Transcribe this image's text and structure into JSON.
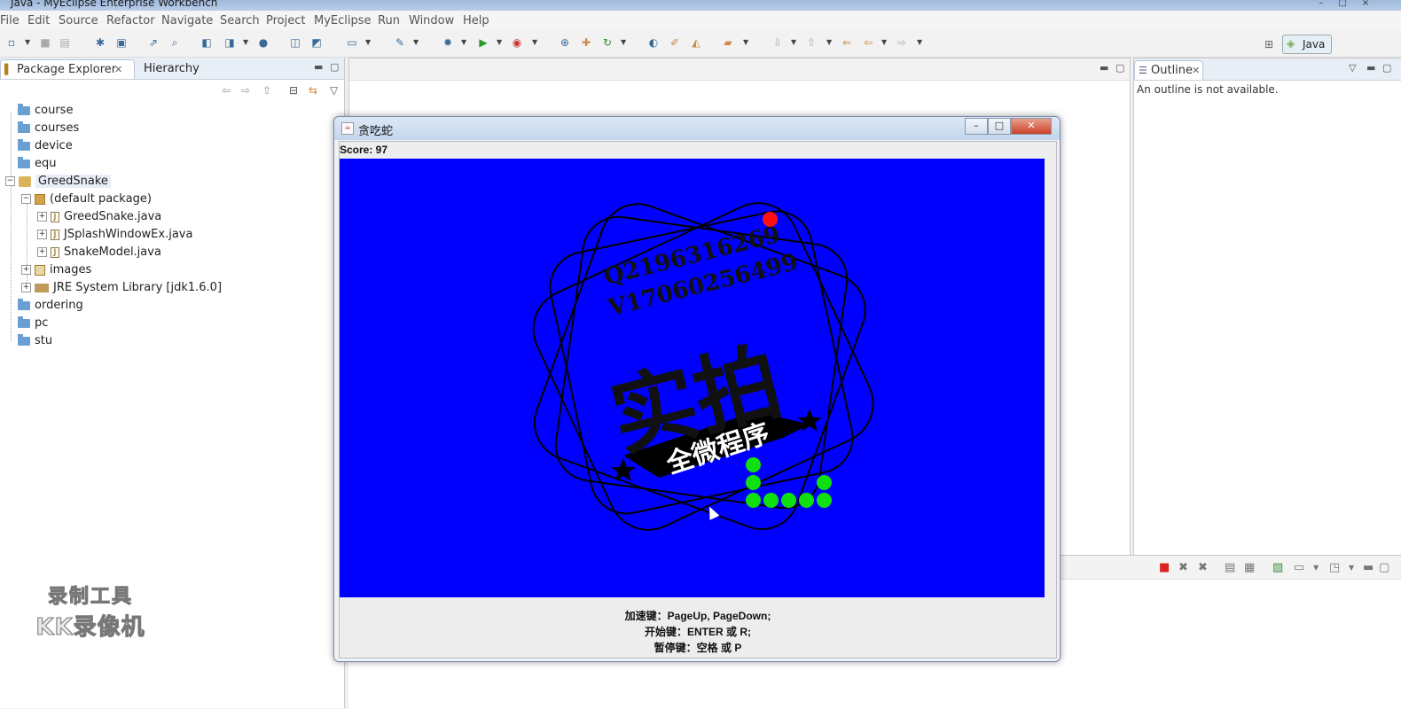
{
  "window": {
    "title": "Java - MyEclipse Enterprise Workbench"
  },
  "menu": [
    "File",
    "Edit",
    "Source",
    "Refactor",
    "Navigate",
    "Search",
    "Project",
    "MyEclipse",
    "Run",
    "Window",
    "Help"
  ],
  "perspective": {
    "label": "Java"
  },
  "package_explorer": {
    "tab_label": "Package Explorer",
    "hierarchy_label": "Hierarchy",
    "tree": [
      {
        "label": "course"
      },
      {
        "label": "courses"
      },
      {
        "label": "device"
      },
      {
        "label": "equ"
      },
      {
        "label": "GreedSnake"
      },
      {
        "label": "(default package)"
      },
      {
        "label": "GreedSnake.java"
      },
      {
        "label": "JSplashWindowEx.java"
      },
      {
        "label": "SnakeModel.java"
      },
      {
        "label": "images"
      },
      {
        "label": "JRE System Library [jdk1.6.0]"
      },
      {
        "label": "ordering"
      },
      {
        "label": "pc"
      },
      {
        "label": "stu"
      }
    ]
  },
  "outline": {
    "tab_label": "Outline",
    "message": "An outline is not available."
  },
  "game": {
    "title": "贪吃蛇",
    "score_text": "Score: 97",
    "help": [
      "加速键：PageUp, PageDown;",
      "开始键：ENTER 或 R;",
      "暂停键：空格 或 P"
    ],
    "board_color": "#0000ff",
    "snake_color": "#10e010",
    "food_color": "#ff1010",
    "stamp": {
      "line1": "Q2196316269",
      "line2": "V17060256499",
      "main": "实拍",
      "banner": "全微程序"
    }
  },
  "watermark": {
    "line1": "录制工具",
    "line2": "KK录像机"
  }
}
